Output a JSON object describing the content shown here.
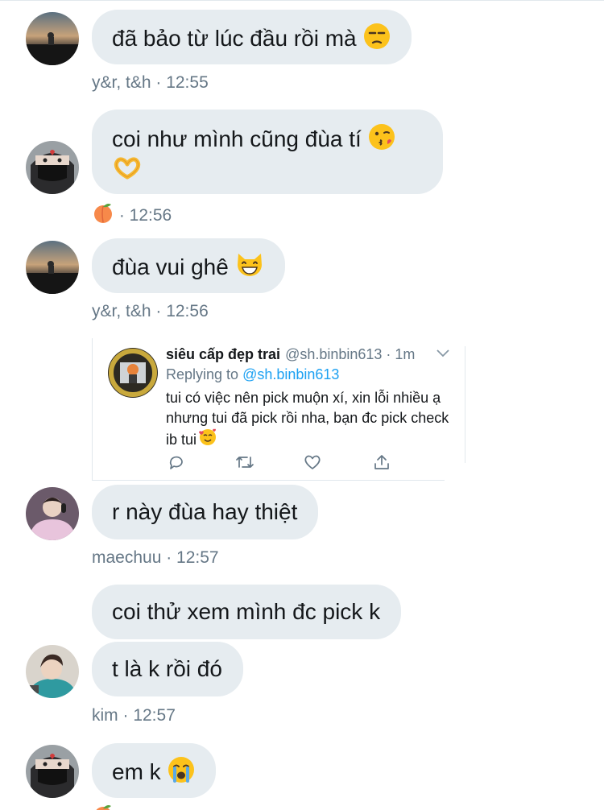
{
  "messages": [
    {
      "text": "đã bảo từ lúc đầu rồi mà",
      "emoji": "unamused-face"
    },
    {
      "text": "coi như mình cũng đùa tí",
      "emoji": "kissing-face",
      "emoji2": "heart-hands"
    },
    {
      "text": "đùa vui ghê",
      "emoji": "grinning-cat"
    },
    {
      "text": "r này đùa hay thiệt"
    },
    {
      "text": "coi thử xem mình đc pick k"
    },
    {
      "text": "t là k rồi đó"
    },
    {
      "text": "em k",
      "emoji": "loudly-crying-face"
    }
  ],
  "meta": [
    {
      "text": "y&r, t&h · 12:55"
    },
    {
      "icon": "peach-emoji",
      "text": " · 12:56"
    },
    {
      "text": "y&r, t&h · 12:56"
    },
    {
      "text": "maechuu · 12:57"
    },
    {
      "text": "kim · 12:57"
    }
  ],
  "tweet": {
    "name": "siêu cấp đẹp trai",
    "handle_time": "@sh.binbin613 · 1m",
    "replying_label": "Replying to",
    "replying_to": "@sh.binbin613",
    "text": "tui có việc nên pick muộn xí, xin lỗi nhiều ạ nhưng tui đã pick rồi nha, bạn đc pick check ib tui",
    "text_emoji": "smiling-face-with-hearts",
    "actions": [
      "reply-icon",
      "retweet-icon",
      "like-icon",
      "share-icon"
    ]
  },
  "colors": {
    "bubble": "#e6ecf0",
    "text": "#14171a",
    "meta": "#657786",
    "link": "#1da1f2",
    "divider": "#e1e8ed"
  }
}
